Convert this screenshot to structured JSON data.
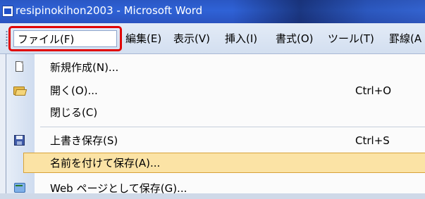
{
  "window": {
    "title": "resipinokihon2003 - Microsoft Word"
  },
  "menubar": {
    "items": [
      {
        "label": "ファイル(F)"
      },
      {
        "label": "編集(E)"
      },
      {
        "label": "表示(V)"
      },
      {
        "label": "挿入(I)"
      },
      {
        "label": "書式(O)"
      },
      {
        "label": "ツール(T)"
      },
      {
        "label": "罫線(A"
      }
    ]
  },
  "file_menu": {
    "items": [
      {
        "label": "新規作成(N)...",
        "shortcut": "",
        "icon": "new-document-icon"
      },
      {
        "label": "開く(O)...",
        "shortcut": "Ctrl+O",
        "icon": "open-folder-icon"
      },
      {
        "label": "閉じる(C)",
        "shortcut": "",
        "icon": ""
      },
      {
        "label": "上書き保存(S)",
        "shortcut": "Ctrl+S",
        "icon": "save-disk-icon"
      },
      {
        "label": "名前を付けて保存(A)...",
        "shortcut": "",
        "icon": "",
        "highlighted": true
      },
      {
        "label": "Web ページとして保存(G)...",
        "shortcut": "",
        "icon": "web-page-icon"
      }
    ]
  },
  "colors": {
    "title_bar": "#2f62d6",
    "highlight_fill": "#fbe3a5",
    "highlight_border": "#d8a238",
    "callout_border": "#e00000"
  }
}
